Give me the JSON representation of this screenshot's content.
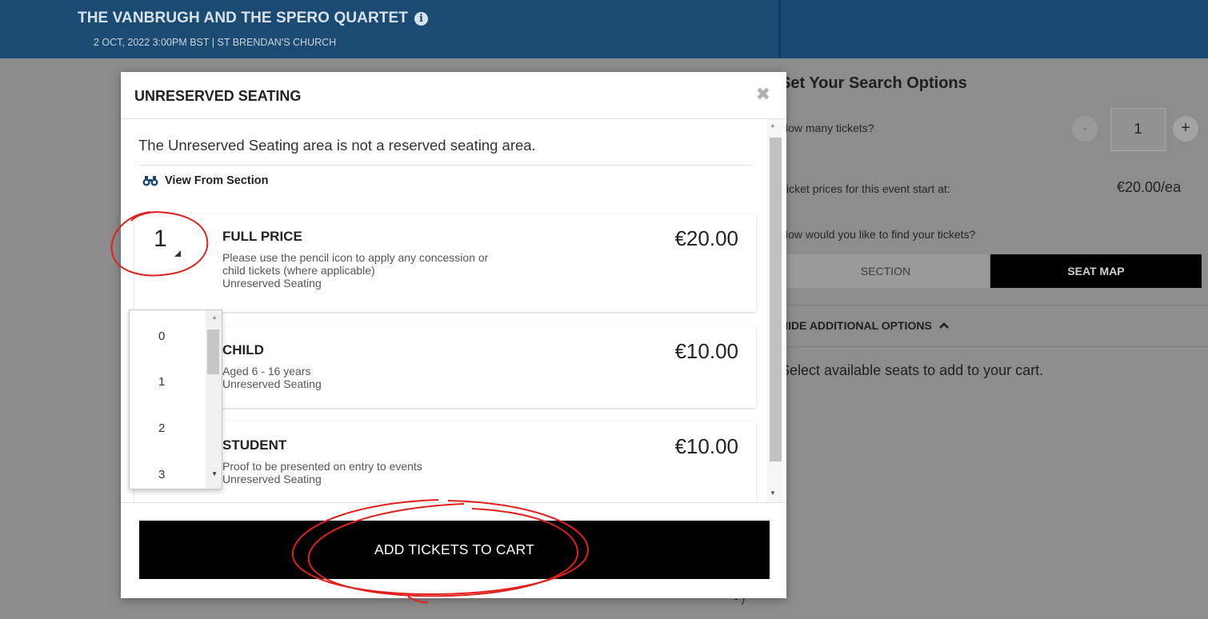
{
  "header": {
    "title": "THE VANBRUGH AND THE SPERO QUARTET",
    "info_icon": "i",
    "subtitle": "2 OCT, 2022 3:00PM BST | ST BRENDAN'S CHURCH"
  },
  "sidebar": {
    "title": "Set Your Search Options",
    "tickets_label": "How many tickets?",
    "minus": "-",
    "quantity": "1",
    "plus": "+",
    "prices_label": "Ticket prices for this event start at:",
    "price_start": "€20.00/ea",
    "find_label": "How would you like to find your tickets?",
    "tab_section": "SECTION",
    "tab_seatmap": "SEAT MAP",
    "hide_options": "HIDE ADDITIONAL OPTIONS",
    "hide_icon": "chevron-up-icon",
    "select_text": "Select available seats to add to your cart.",
    "bottom_glyph": "- )"
  },
  "modal": {
    "title": "UNRESERVED SEATING",
    "close_glyph": "✖",
    "description": "The Unreserved Seating area is not a reserved seating area.",
    "view_section": "View From Section",
    "tickets": [
      {
        "qty": "1",
        "name": "FULL PRICE",
        "desc_lines": [
          "Please use the pencil icon to apply any concession or",
          "child tickets (where applicable)",
          "Unreserved Seating"
        ],
        "price": "€20.00"
      },
      {
        "qty": "",
        "name": "CHILD",
        "desc_lines": [
          "Aged 6 - 16 years",
          "Unreserved Seating"
        ],
        "price": "€10.00"
      },
      {
        "qty": "",
        "name": "STUDENT",
        "desc_lines": [
          "Proof to be presented on entry to events",
          "Unreserved Seating"
        ],
        "price": "€10.00"
      }
    ],
    "add_button": "ADD TICKETS TO CART"
  },
  "quantity_dropdown": {
    "options": [
      "0",
      "1",
      "2",
      "3"
    ]
  },
  "colors": {
    "header_bg": "#1a4a73",
    "button_bg": "#000000",
    "annotation": "#e0201c"
  }
}
